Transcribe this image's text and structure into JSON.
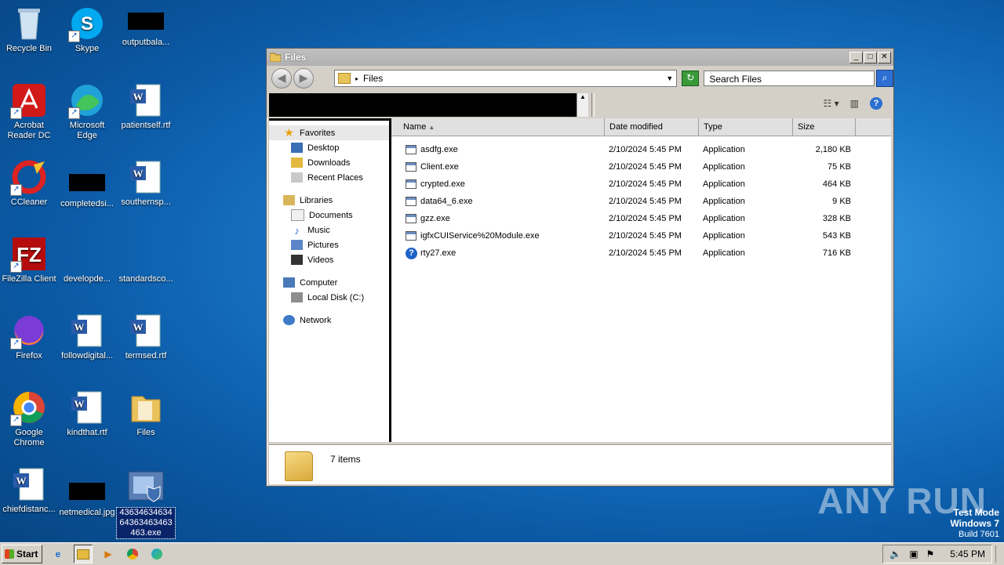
{
  "desktop": {
    "icons": [
      {
        "label": "Recycle Bin",
        "icon": "recycle-bin-icon"
      },
      {
        "label": "Skype",
        "icon": "skype-icon"
      },
      {
        "label": "outputbala...",
        "icon": "redacted-thumbnail"
      },
      {
        "label": "Acrobat Reader DC",
        "icon": "acrobat-icon"
      },
      {
        "label": "Microsoft Edge",
        "icon": "edge-icon"
      },
      {
        "label": "patientself.rtf",
        "icon": "word-doc-icon"
      },
      {
        "label": "CCleaner",
        "icon": "ccleaner-icon"
      },
      {
        "label": "completedsi...",
        "icon": "redacted-thumbnail"
      },
      {
        "label": "southernsp...",
        "icon": "word-doc-icon"
      },
      {
        "label": "FileZilla Client",
        "icon": "filezilla-icon"
      },
      {
        "label": "developde...",
        "icon": "blank-file-icon"
      },
      {
        "label": "standardsco...",
        "icon": "blank-file-icon"
      },
      {
        "label": "Firefox",
        "icon": "firefox-icon"
      },
      {
        "label": "followdigital...",
        "icon": "word-doc-icon"
      },
      {
        "label": "termsed.rtf",
        "icon": "word-doc-icon"
      },
      {
        "label": "Google Chrome",
        "icon": "chrome-icon"
      },
      {
        "label": "kindthat.rtf",
        "icon": "word-doc-icon"
      },
      {
        "label": "Files",
        "icon": "folder-icon"
      },
      {
        "label": "chiefdistanc...",
        "icon": "word-doc-icon"
      },
      {
        "label": "netmedical.jpg",
        "icon": "redacted-thumbnail"
      },
      {
        "label": "4363463463464363463463463.exe",
        "icon": "exe-shield-icon"
      }
    ]
  },
  "window": {
    "title": "Files",
    "address": "Files",
    "search_placeholder": "Search Files",
    "controls": {
      "minimize": "_",
      "maximize": "□",
      "close": "✕"
    }
  },
  "navpane": {
    "favorites": "Favorites",
    "fav_items": [
      "Desktop",
      "Downloads",
      "Recent Places"
    ],
    "libraries": "Libraries",
    "lib_items": [
      "Documents",
      "Music",
      "Pictures",
      "Videos"
    ],
    "computer": "Computer",
    "comp_items": [
      "Local Disk (C:)"
    ],
    "network": "Network"
  },
  "columns": {
    "name": "Name",
    "date": "Date modified",
    "type": "Type",
    "size": "Size"
  },
  "files": [
    {
      "name": "asdfg.exe",
      "date": "2/10/2024 5:45 PM",
      "type": "Application",
      "size": "2,180 KB"
    },
    {
      "name": "Client.exe",
      "date": "2/10/2024 5:45 PM",
      "type": "Application",
      "size": "75 KB"
    },
    {
      "name": "crypted.exe",
      "date": "2/10/2024 5:45 PM",
      "type": "Application",
      "size": "464 KB"
    },
    {
      "name": "data64_6.exe",
      "date": "2/10/2024 5:45 PM",
      "type": "Application",
      "size": "9 KB"
    },
    {
      "name": "gzz.exe",
      "date": "2/10/2024 5:45 PM",
      "type": "Application",
      "size": "328 KB"
    },
    {
      "name": "igfxCUIService%20Module.exe",
      "date": "2/10/2024 5:45 PM",
      "type": "Application",
      "size": "543 KB"
    },
    {
      "name": "rty27.exe",
      "date": "2/10/2024 5:45 PM",
      "type": "Application",
      "size": "716 KB"
    }
  ],
  "details": {
    "count": "7 items"
  },
  "taskbar": {
    "start": "Start",
    "clock": "5:45 PM"
  },
  "watermark": "ANY RUN",
  "testmode": {
    "line1": "Test Mode",
    "line2": "Windows 7",
    "line3": "Build 7601"
  }
}
